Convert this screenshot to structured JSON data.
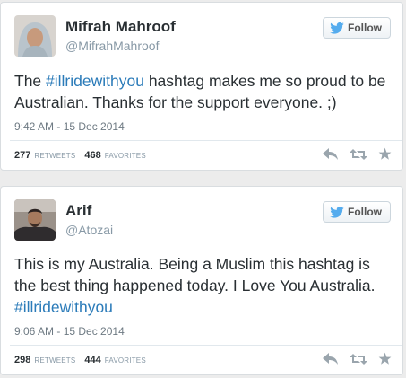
{
  "tweets": [
    {
      "name": "Mifrah Mahroof",
      "handle": "@MifrahMahroof",
      "follow_label": "Follow",
      "text_before": "The ",
      "hashtag": "#illridewithyou",
      "text_after": " hashtag makes me so proud to be Australian. Thanks for the support everyone. ;)",
      "timestamp": "9:42 AM - 15 Dec 2014",
      "retweets": "277",
      "retweets_label": "RETWEETS",
      "favorites": "468",
      "favorites_label": "FAVORITES"
    },
    {
      "name": "Arif",
      "handle": "@Atozai",
      "follow_label": "Follow",
      "text_before": "This is my Australia. Being a Muslim this hashtag is the best thing happened today. I Love You Australia. ",
      "hashtag": "#illridewithyou",
      "text_after": "",
      "timestamp": "9:06 AM - 15 Dec 2014",
      "retweets": "298",
      "retweets_label": "RETWEETS",
      "favorites": "444",
      "favorites_label": "FAVORITES"
    }
  ],
  "colors": {
    "link": "#2b7bb9",
    "twitter_blue": "#55acee",
    "muted": "#8899a6"
  },
  "icons": [
    "twitter-bird-icon",
    "reply-icon",
    "retweet-icon",
    "favorite-star-icon"
  ]
}
